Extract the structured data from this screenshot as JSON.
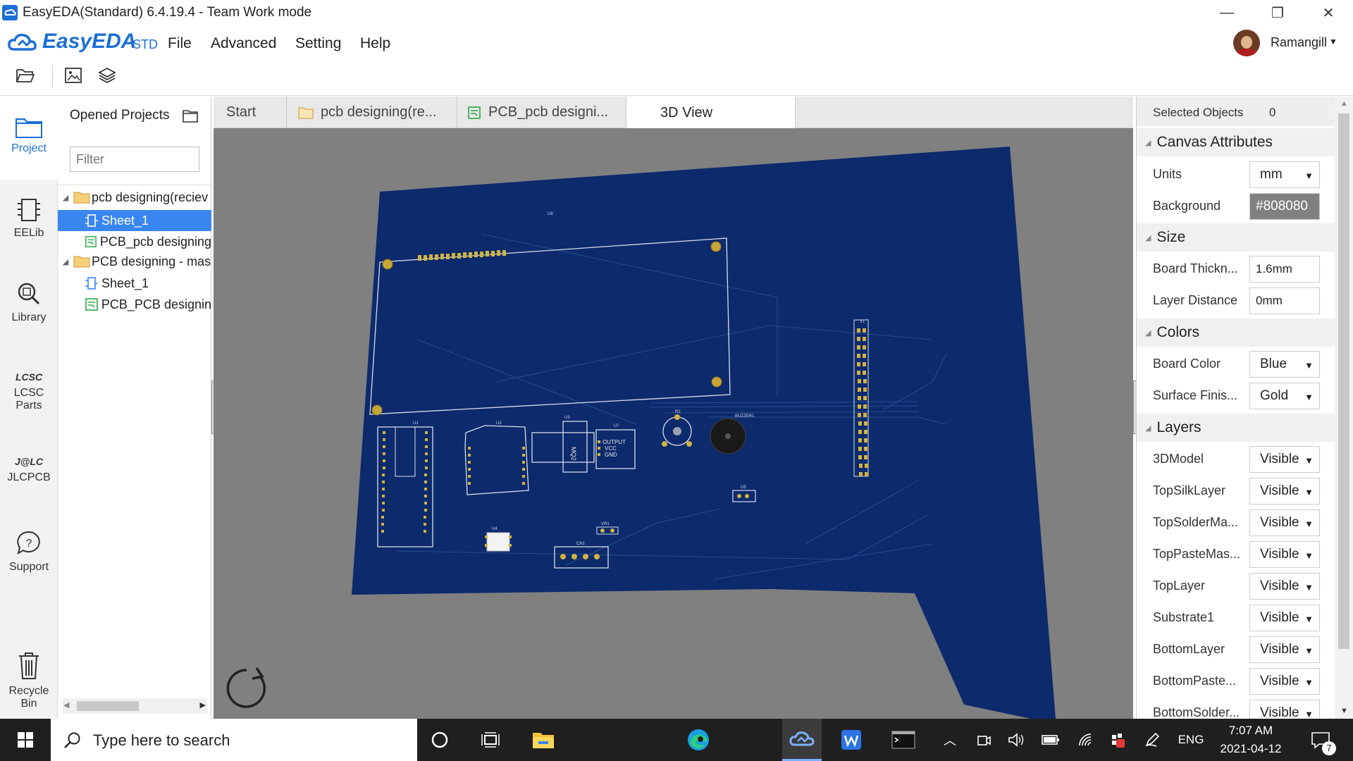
{
  "window": {
    "title": "EasyEDA(Standard) 6.4.19.4 - Team Work mode"
  },
  "menu": {
    "logo": "EasyEDA",
    "logo_suffix": "STD",
    "items": [
      "File",
      "Advanced",
      "Setting",
      "Help"
    ],
    "user": "Ramangill"
  },
  "toolbar": {
    "icons": [
      "folder-open-icon",
      "image-export-icon",
      "layers-icon"
    ]
  },
  "nav": {
    "items": [
      "Project",
      "EELib",
      "Library",
      "LCSC Parts",
      "JLCPCB",
      "Support",
      "Recycle Bin"
    ]
  },
  "projects": {
    "title": "Opened Projects",
    "filter_placeholder": "Filter",
    "tree": [
      {
        "label": "pcb designing(reciev",
        "type": "folder"
      },
      {
        "label": "Sheet_1",
        "type": "sheet",
        "selected": true
      },
      {
        "label": "PCB_pcb designing",
        "type": "pcb"
      },
      {
        "label": "PCB designing - mas",
        "type": "folder"
      },
      {
        "label": "Sheet_1",
        "type": "sheet"
      },
      {
        "label": "PCB_PCB designin",
        "type": "pcb"
      }
    ]
  },
  "tabs": [
    {
      "label": "Start"
    },
    {
      "label": "pcb designing(re..."
    },
    {
      "label": "PCB_pcb designi..."
    },
    {
      "label": "3D View",
      "active": true
    }
  ],
  "canvas": {
    "background": "#808080",
    "board_color": "#0c2a6c",
    "silk_labels": [
      "X1",
      "U1",
      "U2",
      "U3",
      "U7",
      "U4",
      "R2",
      "VR1",
      "CN1",
      "BUZZER1",
      "MQ2",
      "OUTPUT",
      "VCC",
      "GND",
      "U5",
      "U8"
    ]
  },
  "properties": {
    "selected_label": "Selected Objects",
    "selected_count": "0",
    "sections": {
      "canvas": "Canvas Attributes",
      "size": "Size",
      "colors": "Colors",
      "layers": "Layers"
    },
    "units": {
      "label": "Units",
      "value": "mm"
    },
    "background": {
      "label": "Background",
      "value": "#808080"
    },
    "board_thickness": {
      "label": "Board Thickn...",
      "value": "1.6mm"
    },
    "layer_distance": {
      "label": "Layer Distance",
      "value": "0mm"
    },
    "board_color": {
      "label": "Board Color",
      "value": "Blue"
    },
    "surface_finish": {
      "label": "Surface Finis...",
      "value": "Gold"
    },
    "layers": [
      {
        "label": "3DModel",
        "value": "Visible"
      },
      {
        "label": "TopSilkLayer",
        "value": "Visible"
      },
      {
        "label": "TopSolderMa...",
        "value": "Visible"
      },
      {
        "label": "TopPasteMas...",
        "value": "Visible"
      },
      {
        "label": "TopLayer",
        "value": "Visible"
      },
      {
        "label": "Substrate1",
        "value": "Visible"
      },
      {
        "label": "BottomLayer",
        "value": "Visible"
      },
      {
        "label": "BottomPaste...",
        "value": "Visible"
      },
      {
        "label": "BottomSolder...",
        "value": "Visible"
      }
    ]
  },
  "taskbar": {
    "search_placeholder": "Type here to search",
    "lang": "ENG",
    "time": "7:07 AM",
    "date": "2021-04-12",
    "notifications": "7"
  }
}
